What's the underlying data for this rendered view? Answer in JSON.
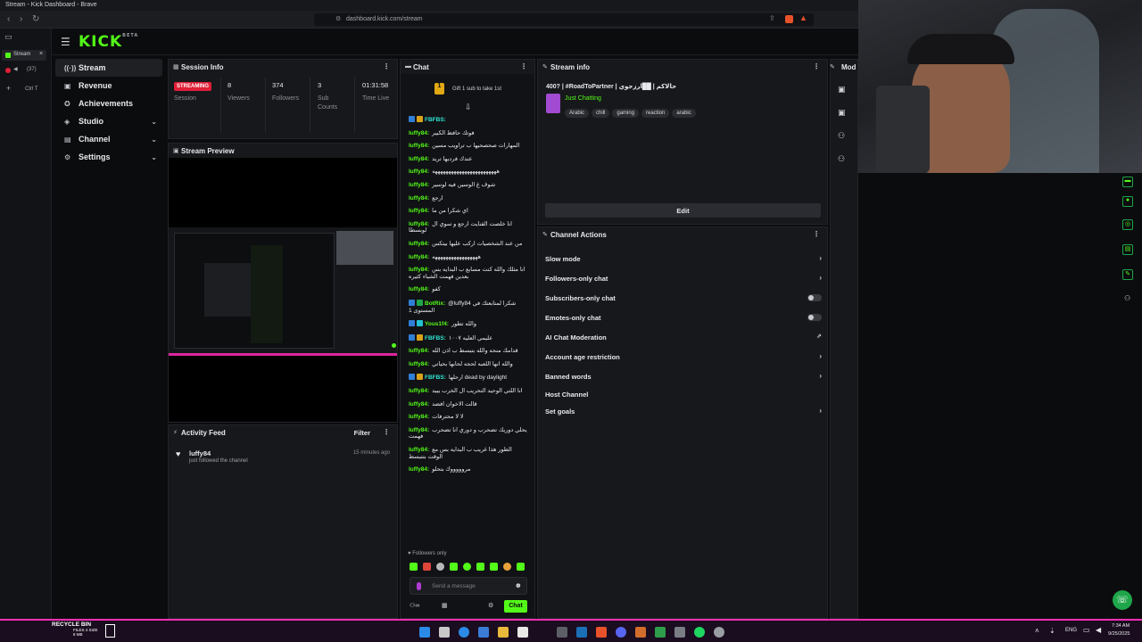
{
  "window": {
    "title": "Stream - Kick Dashboard - Brave",
    "url": "dashboard.kick.com/stream"
  },
  "browser_sidebar": {
    "tabs": [
      {
        "label": "Stream",
        "close": "×"
      },
      {
        "label": "(37)"
      },
      {
        "label": "Ctrl T"
      }
    ]
  },
  "brand": {
    "logo": "KICK",
    "beta": "BETA",
    "accent": "#53fc18"
  },
  "leftnav": {
    "items": [
      {
        "label": "Stream",
        "icon": "radio-icon"
      },
      {
        "label": "Revenue",
        "icon": "wallet-icon"
      },
      {
        "label": "Achievements",
        "icon": "trophy-icon"
      },
      {
        "label": "Studio",
        "icon": "studio-icon"
      },
      {
        "label": "Channel",
        "icon": "channel-icon"
      },
      {
        "label": "Settings",
        "icon": "gear-icon"
      }
    ]
  },
  "session": {
    "title": "Session Info",
    "status": "STREAMING",
    "status_label": "Session",
    "viewers": "8",
    "viewers_label": "Viewers",
    "followers": "374",
    "followers_label": "Followers",
    "subs": "3",
    "subs_label": "Sub Counts",
    "time_live": "01:31:58",
    "time_live_label": "Time Live"
  },
  "preview": {
    "title": "Stream Preview"
  },
  "activity": {
    "title": "Activity Feed",
    "filter": "Filter",
    "items": [
      {
        "user": "luffy84",
        "text": "just followed the channel",
        "time": "15 minutes ago"
      }
    ]
  },
  "chat": {
    "title": "Chat",
    "gift_text": "Gift 1 sub to take 1st",
    "messages": [
      {
        "user": "FBFBS:",
        "text": "",
        "badges": [
          "blue",
          "gold"
        ],
        "cyan": true
      },
      {
        "user": "luffy84:",
        "text": "فوتك حافظ الكبير"
      },
      {
        "user": "luffy84:",
        "text": "المهارات صحصحيها ب تراويب مسين"
      },
      {
        "user": "luffy84:",
        "text": "عندك فرديها تريد"
      },
      {
        "user": "luffy84:",
        "text": "ههههههههههههههههههههههههه"
      },
      {
        "user": "luffy84:",
        "text": "شوف غ الوسين فيه لوسير"
      },
      {
        "user": "luffy84:",
        "text": "ارجع"
      },
      {
        "user": "luffy84:",
        "text": "اي شكرا من ما"
      },
      {
        "user": "luffy84:",
        "text": "انا خلصت القنايت ارجع و سوي ال لوبسطا"
      },
      {
        "user": "luffy84:",
        "text": "من عند الشخصيات اركب عليها بيتكس"
      },
      {
        "user": "luffy84:",
        "text": "هههههههههههههههههه"
      },
      {
        "user": "luffy84:",
        "text": "انا مثلك والله كنت مسابع ب البدايه بس بعدين فهمت الشياء كثيره"
      },
      {
        "user": "luffy84:",
        "text": "كفو"
      },
      {
        "user": "BotRix:",
        "text": "@luffy84 شكرا لمتابعتك في المستوى 1",
        "badges": [
          "blue",
          "green"
        ]
      },
      {
        "user": "Yous1f4:",
        "text": "والله تطور",
        "badges": [
          "blue",
          "cyan"
        ]
      },
      {
        "user": "FBFBS:",
        "text": "عليمي العليه ١٠٠٧",
        "badges": [
          "blue",
          "gold"
        ],
        "cyan": true
      },
      {
        "user": "luffy84:",
        "text": "قدامك منحه والله بتبسط ب اذن الله"
      },
      {
        "user": "luffy84:",
        "text": "والله انها اللعبه لحجه لحابها بحياتي"
      },
      {
        "user": "FBFBS:",
        "text": "ارحلها dead by daylight",
        "badges": [
          "blue",
          "gold"
        ],
        "cyan": true
      },
      {
        "user": "luffy84:",
        "text": "انا اللتي الوحيد التحريب ال الخرب يبيد"
      },
      {
        "user": "luffy84:",
        "text": "قالت الاخوان افضد"
      },
      {
        "user": "luffy84:",
        "text": "لا لا محترفات"
      },
      {
        "user": "luffy84:",
        "text": "يحلي دوريك تضحرب و دوري انا تضحرب فهمت"
      },
      {
        "user": "luffy84:",
        "text": "الطور هذا غريب ب البدايه بس مع الوقت بتتبسط"
      },
      {
        "user": "luffy84:",
        "text": "مروووووك بتحلو"
      }
    ],
    "followers_only": "Followers only",
    "placeholder": "Send a message",
    "send": "Chat"
  },
  "stream_info": {
    "title": "Stream info",
    "stream_title": "400? | #RoadToPartner | حالاكم | ██ارزجوي",
    "category": "Just Chatting",
    "tags": [
      "Arabic",
      "chill",
      "gaming",
      "reaction",
      "arabic"
    ],
    "edit": "Edit"
  },
  "channel_actions": {
    "title": "Channel Actions",
    "items": [
      {
        "label": "Slow mode",
        "kind": "chevron"
      },
      {
        "label": "Followers-only chat",
        "kind": "chevron"
      },
      {
        "label": "Subscribers-only chat",
        "kind": "toggle"
      },
      {
        "label": "Emotes-only chat",
        "kind": "toggle"
      },
      {
        "label": "AI Chat Moderation",
        "kind": "external"
      },
      {
        "label": "Account age restriction",
        "kind": "chevron"
      },
      {
        "label": "Banned words",
        "kind": "chevron"
      },
      {
        "label": "Host Channel",
        "kind": "none"
      },
      {
        "label": "Set goals",
        "kind": "chevron"
      }
    ]
  },
  "mod_panel": {
    "title": "Mod"
  },
  "taskbar": {
    "recycle": "RECYCLE BIN",
    "recycle_sub": "FILES 4 SIZE 8 MB",
    "lang": "ENG",
    "time": "7:34 AM",
    "date": "9/25/2025"
  }
}
